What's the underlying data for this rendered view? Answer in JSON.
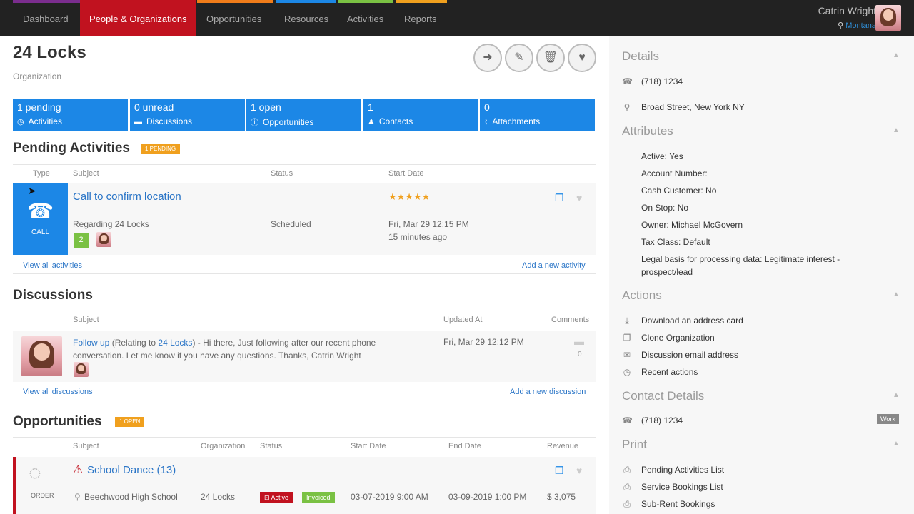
{
  "nav": {
    "items": [
      "Dashboard",
      "People & Organizations",
      "Opportunities",
      "Resources",
      "Activities",
      "Reports"
    ],
    "active_index": 1,
    "accent_colors": [
      "#7b2d8e",
      "#c1121f",
      "#f07c1a",
      "#1c87e6",
      "#7ac143",
      "#f0a01e"
    ]
  },
  "user": {
    "name": "Catrin Wright",
    "location": "Montana"
  },
  "org": {
    "name": "24 Locks",
    "type": "Organization"
  },
  "toolbar": {
    "icons": [
      "back-icon",
      "edit-icon",
      "trash-icon",
      "heart-icon"
    ]
  },
  "stats": [
    {
      "count": "1 pending",
      "label": "Activities",
      "icon": "clock-icon"
    },
    {
      "count": "0 unread",
      "label": "Discussions",
      "icon": "chat-icon"
    },
    {
      "count": "1 open",
      "label": "Opportunities",
      "icon": "exclamation-icon"
    },
    {
      "count": "1",
      "label": "Contacts",
      "icon": "person-icon"
    },
    {
      "count": "0",
      "label": "Attachments",
      "icon": "paperclip-icon"
    }
  ],
  "pending": {
    "title": "Pending Activities",
    "badge": "1 PENDING",
    "columns": [
      "Type",
      "Subject",
      "Status",
      "Start Date"
    ],
    "row": {
      "type_label": "CALL",
      "subject": "Call to confirm location",
      "regarding": "Regarding 24 Locks",
      "count": "2",
      "status": "Scheduled",
      "rating_stars": 5,
      "date": "Fri, Mar 29 12:15 PM",
      "ago": "15 minutes ago"
    },
    "view_all": "View all activities",
    "add_new": "Add a new activity"
  },
  "discussions": {
    "title": "Discussions",
    "columns": [
      "Subject",
      "Updated At",
      "Comments"
    ],
    "row": {
      "subject": "Follow up",
      "relating_prefix": "(Relating to ",
      "relating_to": "24 Locks",
      "relating_suffix": ")",
      "body": " - Hi there, Just following after our recent phone conversation. Let me know if you have any questions. Thanks, Catrin Wright",
      "updated": "Fri, Mar 29 12:12 PM",
      "comments": "0"
    },
    "view_all": "View all discussions",
    "add_new": "Add a new discussion"
  },
  "opportunities": {
    "title": "Opportunities",
    "badge": "1 OPEN",
    "columns": [
      "Subject",
      "Organization",
      "Status",
      "Start Date",
      "End Date",
      "Revenue"
    ],
    "row": {
      "type_label": "ORDER",
      "subject": "School Dance (13)",
      "venue": "Beechwood High School",
      "organization": "24 Locks",
      "status_active": "Active",
      "status_invoiced": "Invoiced",
      "start": "03-07-2019 9:00 AM",
      "end": "03-09-2019 1:00 PM",
      "revenue": "$ 3,075"
    }
  },
  "details": {
    "title": "Details",
    "phone": "(718) 1234",
    "address": "Broad Street, New York NY"
  },
  "attributes": {
    "title": "Attributes",
    "items": [
      "Active: Yes",
      "Account Number:",
      "Cash Customer: No",
      "On Stop: No",
      "Owner: Michael McGovern",
      "Tax Class: Default",
      "Legal basis for processing data: Legitimate interest -",
      "prospect/lead"
    ]
  },
  "actions": {
    "title": "Actions",
    "items": [
      "Download an address card",
      "Clone Organization",
      "Discussion email address",
      "Recent actions"
    ]
  },
  "contact_details": {
    "title": "Contact Details",
    "phone": "(718) 1234",
    "tag": "Work"
  },
  "print": {
    "title": "Print",
    "items": [
      "Pending Activities List",
      "Service Bookings List",
      "Sub-Rent Bookings"
    ]
  }
}
